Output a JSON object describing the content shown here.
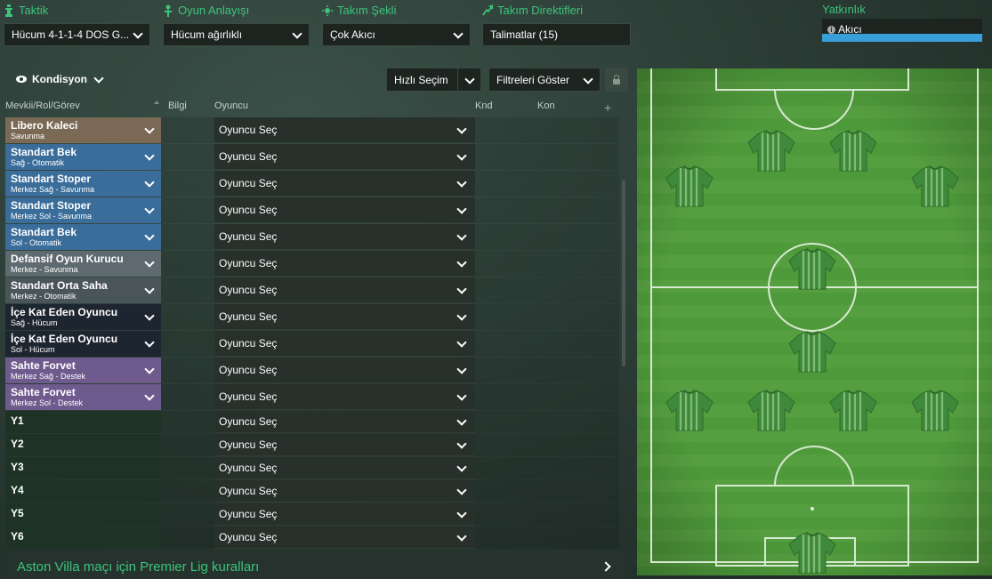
{
  "colors": {
    "accent_green": "#3dc37c",
    "fluidity_bar": "#3a9fd9",
    "role_goalkeeper": "#7a6a55",
    "role_defence": "#3a6d9a",
    "role_midfield_grey": "#5e6a6f",
    "role_midfield_dark": "#4a555a",
    "role_attack_dark": "#1d2530",
    "role_forward_purple": "#6f5a8e"
  },
  "topbar": {
    "taktik": {
      "label": "Taktik",
      "icon": "tactic-icon",
      "value": "Hücum 4-1-1-4 DOS G..."
    },
    "oyun_anlayisi": {
      "label": "Oyun Anlayışı",
      "icon": "mentality-icon",
      "value": "Hücum ağırlıklı"
    },
    "takim_sekli": {
      "label": "Takım Şekli",
      "icon": "team-shape-icon",
      "value": "Çok Akıcı"
    },
    "direktifler": {
      "label": "Takım Direktifleri",
      "icon": "instructions-icon",
      "value": "Talimatlar (15)"
    },
    "yatkinlik": {
      "label": "Yatkınlık",
      "value": "Akıcı",
      "level_percent": 100
    }
  },
  "toolbar": {
    "kondisyon": "Kondisyon",
    "hizli_secim": "Hızlı Seçim",
    "filtreler": "Filtreleri Göster"
  },
  "columns": {
    "mevkii": "Mevkii/Rol/Görev",
    "bilgi": "Bilgi",
    "oyuncu": "Oyuncu",
    "knd": "Knd",
    "kon": "Kon"
  },
  "rows": [
    {
      "name": "Libero Kaleci",
      "sub": "Savunma",
      "group": "gk",
      "player": "Oyuncu Seç"
    },
    {
      "name": "Standart Bek",
      "sub": "Sağ - Otomatik",
      "group": "def",
      "player": "Oyuncu Seç"
    },
    {
      "name": "Standart Stoper",
      "sub": "Merkez Sağ - Savunma",
      "group": "def",
      "player": "Oyuncu Seç"
    },
    {
      "name": "Standart Stoper",
      "sub": "Merkez Sol - Savunma",
      "group": "def",
      "player": "Oyuncu Seç"
    },
    {
      "name": "Standart Bek",
      "sub": "Sol - Otomatik",
      "group": "def",
      "player": "Oyuncu Seç"
    },
    {
      "name": "Defansif Oyun Kurucu",
      "sub": "Merkez - Savunma",
      "group": "dm",
      "player": "Oyuncu Seç"
    },
    {
      "name": "Standart Orta Saha",
      "sub": "Merkez - Otomatik",
      "group": "mid",
      "player": "Oyuncu Seç"
    },
    {
      "name": "İçe Kat Eden Oyuncu",
      "sub": "Sağ - Hücum",
      "group": "att",
      "player": "Oyuncu Seç"
    },
    {
      "name": "İçe Kat Eden Oyuncu",
      "sub": "Sol - Hücum",
      "group": "att",
      "player": "Oyuncu Seç"
    },
    {
      "name": "Sahte Forvet",
      "sub": "Merkez Sağ - Destek",
      "group": "fwd",
      "player": "Oyuncu Seç"
    },
    {
      "name": "Sahte Forvet",
      "sub": "Merkez Sol - Destek",
      "group": "fwd",
      "player": "Oyuncu Seç"
    },
    {
      "name": "Y1",
      "sub": "",
      "group": "sub",
      "player": "Oyuncu Seç"
    },
    {
      "name": "Y2",
      "sub": "",
      "group": "sub",
      "player": "Oyuncu Seç"
    },
    {
      "name": "Y3",
      "sub": "",
      "group": "sub",
      "player": "Oyuncu Seç"
    },
    {
      "name": "Y4",
      "sub": "",
      "group": "sub",
      "player": "Oyuncu Seç"
    },
    {
      "name": "Y5",
      "sub": "",
      "group": "sub",
      "player": "Oyuncu Seç"
    },
    {
      "name": "Y6",
      "sub": "",
      "group": "sub",
      "player": "Oyuncu Seç"
    }
  ],
  "footer": {
    "text": "Aston Villa maçı için Premier Lig kuralları"
  }
}
